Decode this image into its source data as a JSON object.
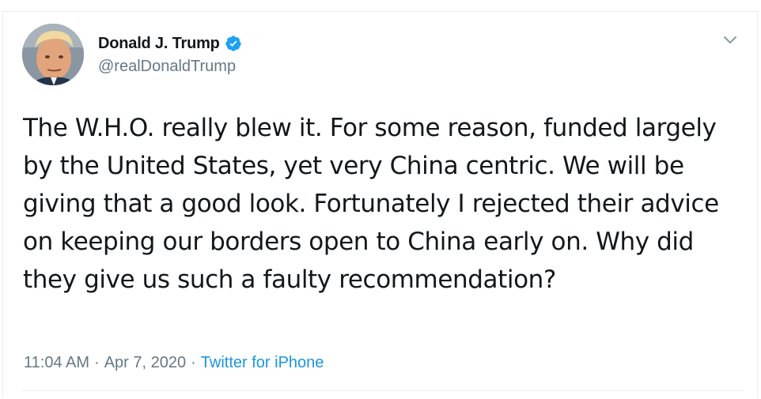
{
  "tweet": {
    "display_name": "Donald J. Trump",
    "handle": "@realDonaldTrump",
    "verified": true,
    "text": "The W.H.O. really blew it. For some reason, funded largely by the United States, yet very China centric. We will be giving that a good look. Fortunately I rejected their advice on keeping our borders open to China early on. Why did they give us such a faulty recommendation?",
    "time": "11:04 AM",
    "separator": "·",
    "date": "Apr 7, 2020",
    "source": "Twitter for iPhone"
  },
  "icons": {
    "verified": "verified-badge-icon",
    "menu": "chevron-down-icon"
  },
  "colors": {
    "text_primary": "#14171a",
    "text_secondary": "#657786",
    "link": "#1b95e0",
    "verified": "#1da1f2",
    "border": "#e6ecf0"
  }
}
